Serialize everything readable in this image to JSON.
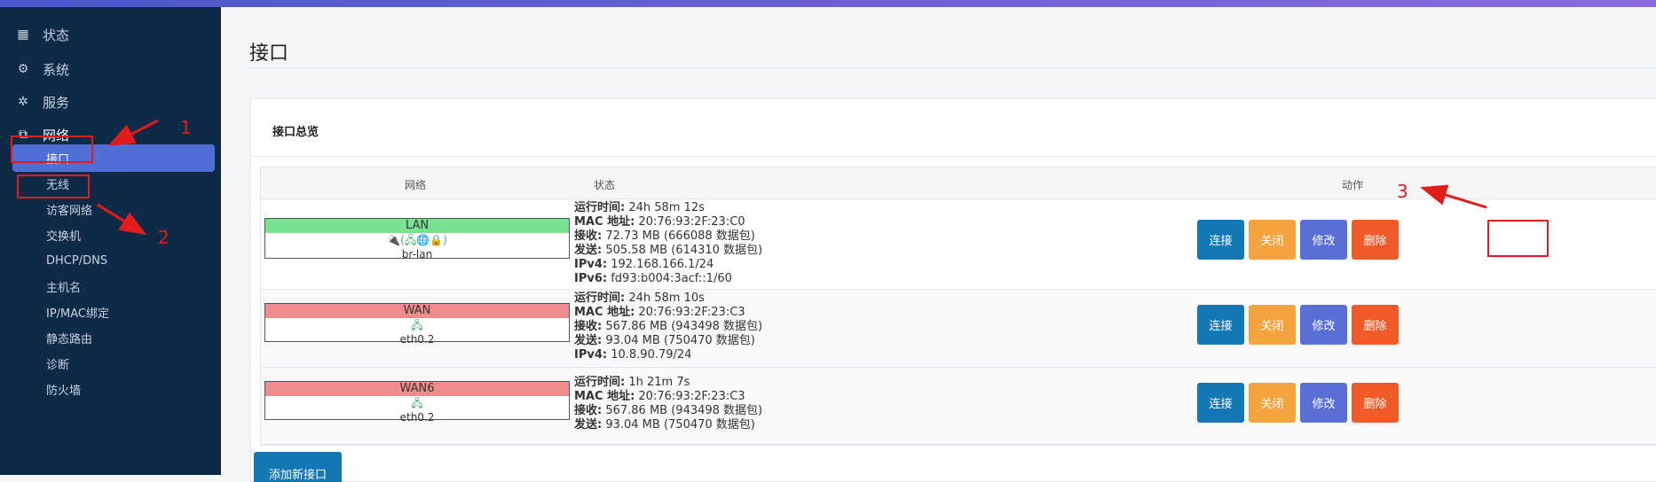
{
  "sidebar": {
    "items": [
      {
        "label": "状态",
        "icon": "dashboard-icon"
      },
      {
        "label": "系统",
        "icon": "gear-icon"
      },
      {
        "label": "服务",
        "icon": "gears-icon"
      },
      {
        "label": "网络",
        "icon": "sitemap-icon"
      }
    ],
    "subitems": [
      "接口",
      "无线",
      "访客网络",
      "交换机",
      "DHCP/DNS",
      "主机名",
      "IP/MAC绑定",
      "静态路由",
      "诊断",
      "防火墙"
    ]
  },
  "page": {
    "title": "接口"
  },
  "card": {
    "title": "接口总览"
  },
  "table": {
    "headers": {
      "network": "网络",
      "status": "状态",
      "actions": "动作"
    },
    "rows": [
      {
        "name": "LAN",
        "color": "#77e38f",
        "icons": "🔌(🖧🌐🔒)",
        "device": "br-lan",
        "status": [
          {
            "k": "运行时间:",
            "v": " 24h 58m 12s"
          },
          {
            "k": "MAC 地址:",
            "v": " 20:76:93:2F:23:C0"
          },
          {
            "k": "接收:",
            "v": " 72.73 MB (666088 数据包)"
          },
          {
            "k": "发送:",
            "v": " 505.58 MB (614310 数据包)"
          },
          {
            "k": "IPv4:",
            "v": " 192.168.166.1/24"
          },
          {
            "k": "IPv6:",
            "v": " fd93:b004:3acf::1/60"
          }
        ]
      },
      {
        "name": "WAN",
        "color": "#f28c8c",
        "icons": "🖧",
        "device": "eth0.2",
        "status": [
          {
            "k": "运行时间:",
            "v": " 24h 58m 10s"
          },
          {
            "k": "MAC 地址:",
            "v": " 20:76:93:2F:23:C3"
          },
          {
            "k": "接收:",
            "v": " 567.86 MB (943498 数据包)"
          },
          {
            "k": "发送:",
            "v": " 93.04 MB (750470 数据包)"
          },
          {
            "k": "IPv4:",
            "v": " 10.8.90.79/24"
          }
        ]
      },
      {
        "name": "WAN6",
        "color": "#f28c8c",
        "icons": "🖧",
        "device": "eth0.2",
        "status": [
          {
            "k": "运行时间:",
            "v": " 1h 21m 7s"
          },
          {
            "k": "MAC 地址:",
            "v": " 20:76:93:2F:23:C3"
          },
          {
            "k": "接收:",
            "v": " 567.86 MB (943498 数据包)"
          },
          {
            "k": "发送:",
            "v": " 93.04 MB (750470 数据包)"
          }
        ]
      }
    ],
    "buttons": {
      "connect": "连接",
      "close": "关闭",
      "edit": "修改",
      "delete": "删除"
    }
  },
  "add_button": "添加新接口",
  "annotations": [
    "1",
    "2",
    "3"
  ],
  "colors": {
    "sidebar_bg": "#0e2a47",
    "active": "#4f6fd6",
    "annotation": "#e21b1b"
  }
}
